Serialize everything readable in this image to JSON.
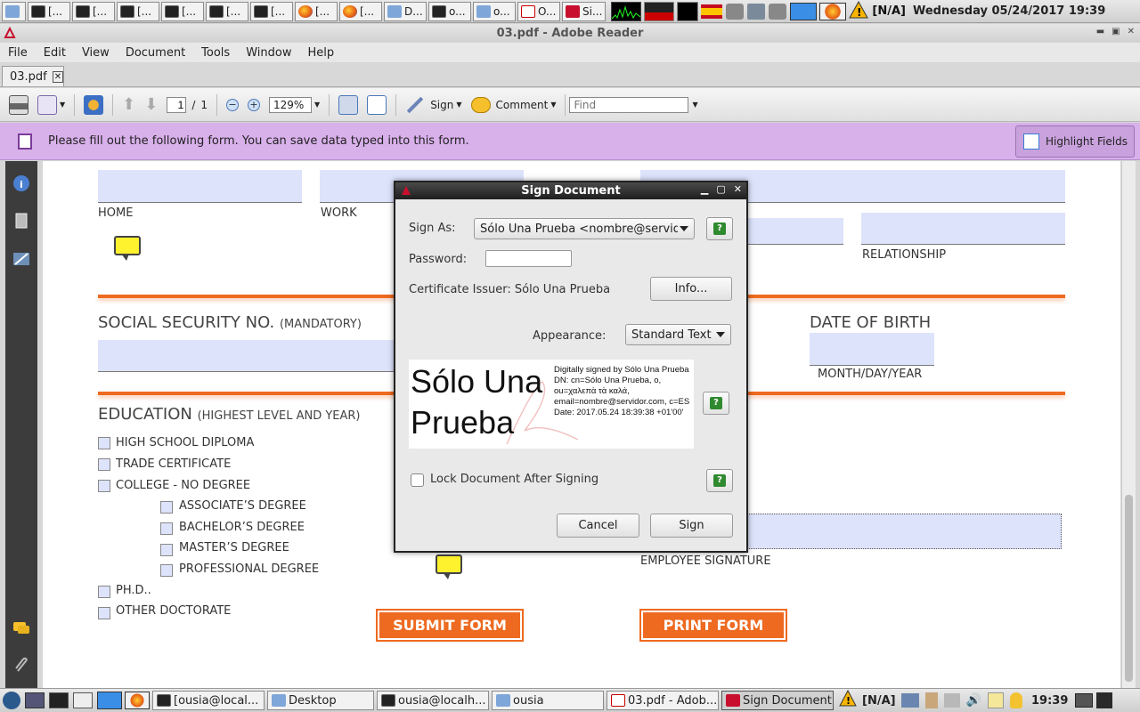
{
  "top_taskbar": {
    "buttons": [
      {
        "label": "[...",
        "icon": "terminal-icon"
      },
      {
        "label": "[...",
        "icon": "terminal-icon"
      },
      {
        "label": "[...",
        "icon": "terminal-icon"
      },
      {
        "label": "[...",
        "icon": "terminal-icon"
      },
      {
        "label": "[...",
        "icon": "terminal-icon"
      },
      {
        "label": "[...",
        "icon": "terminal-icon"
      },
      {
        "label": "[...",
        "icon": "firefox-icon"
      },
      {
        "label": "[...",
        "icon": "firefox-icon"
      },
      {
        "label": "D...",
        "icon": "folder-icon"
      },
      {
        "label": "o...",
        "icon": "terminal-icon"
      },
      {
        "label": "o...",
        "icon": "folder-icon"
      },
      {
        "label": "O...",
        "icon": "pdf-icon"
      },
      {
        "label": "Si...",
        "icon": "adobe-icon"
      }
    ],
    "status": "[N/A]",
    "clock": "Wednesday 05/24/2017 19:39"
  },
  "window": {
    "title": "03.pdf - Adobe Reader"
  },
  "menu": [
    "File",
    "Edit",
    "View",
    "Document",
    "Tools",
    "Window",
    "Help"
  ],
  "doc_tab": "03.pdf",
  "toolbar": {
    "page_current": "1",
    "page_separator": "/",
    "page_total": "1",
    "zoom": "129%",
    "sign_label": "Sign",
    "comment_label": "Comment",
    "find_placeholder": "Find"
  },
  "infobar": {
    "message": "Please fill out the following form. You can save data typed into this form.",
    "highlight_label": "Highlight Fields"
  },
  "form": {
    "home_label": "HOME",
    "work_label": "WORK",
    "relationship_label": "RELATIONSHIP",
    "ssn_title": "SOCIAL SECURITY NO.",
    "ssn_note": "(MANDATORY)",
    "dob_title": "DATE OF BIRTH",
    "dob_hint": "MONTH/DAY/YEAR",
    "education_title": "EDUCATION",
    "education_note": "(HIGHEST LEVEL AND YEAR)",
    "education_options": [
      "HIGH SCHOOL DIPLOMA",
      "TRADE CERTIFICATE",
      "COLLEGE - NO DEGREE",
      "ASSOCIATE’S DEGREE",
      "BACHELOR’S DEGREE",
      "MASTER’S DEGREE",
      "PROFESSIONAL DEGREE",
      "PH.D..",
      "OTHER DOCTORATE"
    ],
    "employee_signature_label": "EMPLOYEE SIGNATURE",
    "submit_label": "SUBMIT FORM",
    "print_label": "PRINT FORM"
  },
  "dialog": {
    "title": "Sign Document",
    "sign_as_label": "Sign As:",
    "sign_as_value": "Sólo Una Prueba <nombre@servidor.com>",
    "password_label": "Password:",
    "password_value": "",
    "issuer_label": "Certificate Issuer: Sólo Una Prueba",
    "info_button": "Info...",
    "appearance_label": "Appearance:",
    "appearance_value": "Standard Text",
    "preview_name": "Sólo Una Prueba",
    "preview_details": [
      "Digitally signed by Sólo Una Prueba",
      "DN: cn=Sólo Una Prueba, o, ou=χαλεπὰ τὰ καλά, email=nombre@servidor.com, c=ES",
      "Date: 2017.05.24 18:39:38 +01'00'"
    ],
    "lock_label": "Lock Document After Signing",
    "lock_checked": false,
    "cancel_button": "Cancel",
    "sign_button": "Sign"
  },
  "bottom_taskbar": {
    "buttons": [
      {
        "label": "[ousia@local...",
        "icon": "terminal-icon"
      },
      {
        "label": "Desktop",
        "icon": "folder-icon"
      },
      {
        "label": "ousia@localh...",
        "icon": "terminal-icon"
      },
      {
        "label": "ousia",
        "icon": "folder-icon"
      },
      {
        "label": "03.pdf - Adob...",
        "icon": "pdf-icon"
      },
      {
        "label": "Sign Document",
        "icon": "adobe-icon"
      }
    ],
    "status": "[N/A]",
    "clock": "19:39"
  },
  "colors": {
    "accent_orange": "#ee6a20",
    "field_fill": "#dde3fb",
    "infobar_purple": "#d8b0ea",
    "adobe_red": "#c8102e"
  }
}
